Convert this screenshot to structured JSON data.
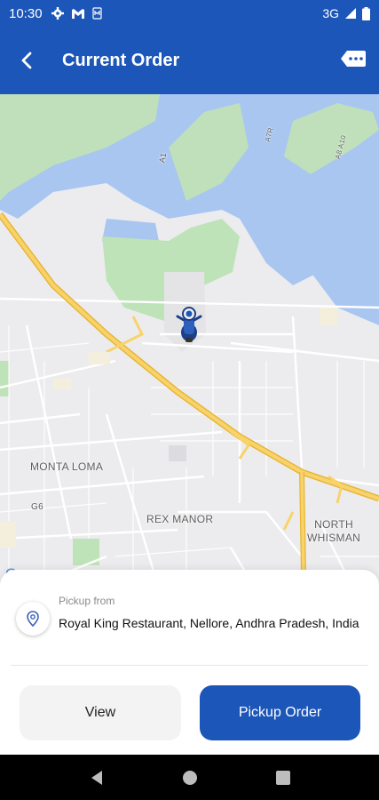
{
  "status_bar": {
    "time": "10:30",
    "network": "3G",
    "icons": [
      "gear-icon",
      "gmail-icon",
      "sim-icon",
      "signal-icon",
      "battery-icon"
    ]
  },
  "app_bar": {
    "title": "Current Order",
    "back_icon": "chevron-left-icon",
    "chat_icon": "chat-bubble-icon"
  },
  "map": {
    "labels": {
      "monta_loma": "MONTA LOMA",
      "rex_manor": "REX MANOR",
      "north_whisman": "NORTH\nWHISMAN",
      "g6": "G6",
      "a1": "A1",
      "a7r": "A7R",
      "a8": "A8 A10"
    },
    "marker_icon": "delivery-scooter-icon"
  },
  "pickup": {
    "caption": "Pickup from",
    "address": "Royal King Restaurant, Nellore, Andhra Pradesh, India",
    "icon": "location-pin-icon"
  },
  "actions": {
    "view_label": "View",
    "pickup_label": "Pickup Order"
  },
  "colors": {
    "primary": "#1c56b8",
    "water": "#a9c6f1",
    "park": "#bfe3b8",
    "highway": "#f5c542"
  }
}
